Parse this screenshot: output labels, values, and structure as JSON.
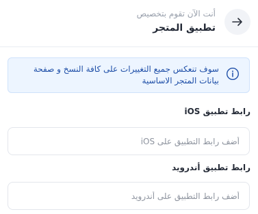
{
  "header": {
    "subtitle": "أنت الآن تقوم بتخصيص",
    "title": "تطبيق المتجر",
    "back_icon": "arrow-right-icon"
  },
  "notice": {
    "icon": "info-icon",
    "text": "سوف تنعكس جميع التغييرات على كافة النسخ و صفحة بيانات المتجر الاساسية",
    "accent": "#1f4fa8"
  },
  "ios": {
    "label": "رابط تطبيق iOS",
    "placeholder": "أضف رابط التطبيق على iOS",
    "value": ""
  },
  "android": {
    "label": "رابط تطبيق أندرويد",
    "placeholder": "أضف رابط التطبيق على أندرويد",
    "value": ""
  }
}
